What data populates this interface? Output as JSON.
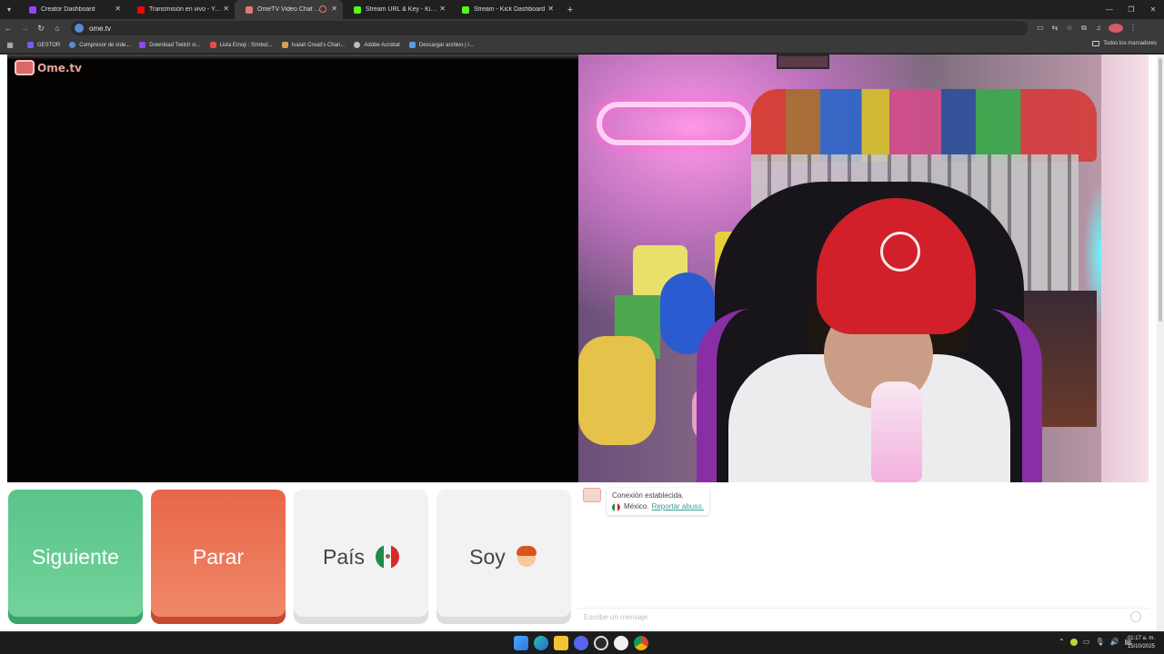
{
  "browser": {
    "tabs": [
      {
        "title": "Creator Dashboard",
        "favicon_color": "#9146ff",
        "active": false
      },
      {
        "title": "Transmisión en vivo - YouTube",
        "favicon_color": "#ff0000",
        "active": false
      },
      {
        "title": "OmeTV Video Chat — Ome",
        "favicon_color": "#e07a7a",
        "active": true,
        "recording": true
      },
      {
        "title": "Stream URL & Key - Kick Dashb",
        "favicon_color": "#53fc18",
        "active": false
      },
      {
        "title": "Stream - Kick Dashboard",
        "favicon_color": "#53fc18",
        "active": false
      }
    ],
    "url": "ome.tv",
    "bookmarks": [
      {
        "label": "GESTOR",
        "icon_color": "#7a5af8"
      },
      {
        "label": "Compresor de víde...",
        "icon_color": "#5a8ad8"
      },
      {
        "label": "Download Twitch vi...",
        "icon_color": "#9146ff"
      },
      {
        "label": "Lista Emoji : Símbol...",
        "icon_color": "#e84a4a"
      },
      {
        "label": "Isaiah Creati's Chan...",
        "icon_color": "#d8a04a"
      },
      {
        "label": "Adobe Acrobat",
        "icon_color": "#bfbfbf"
      },
      {
        "label": "Descargar archivo | i...",
        "icon_color": "#5a9ae8"
      }
    ],
    "bookmarks_all": "Todos los marcadores"
  },
  "app": {
    "logo_text": "Ome.tv",
    "buttons": {
      "next": "Siguiente",
      "stop": "Parar",
      "country": "País",
      "gender": "Soy"
    },
    "chat": {
      "status": "Conexión establecida.",
      "country": "México.",
      "report": "Reportar abuso.",
      "input_placeholder": "Escribe un mensaje"
    }
  },
  "taskbar": {
    "time": "01:17 a. m.",
    "date": "15/10/2025"
  },
  "colors": {
    "next_green": "#5ac48a",
    "stop_orange": "#e8664a",
    "link_teal": "#3a9d96"
  }
}
